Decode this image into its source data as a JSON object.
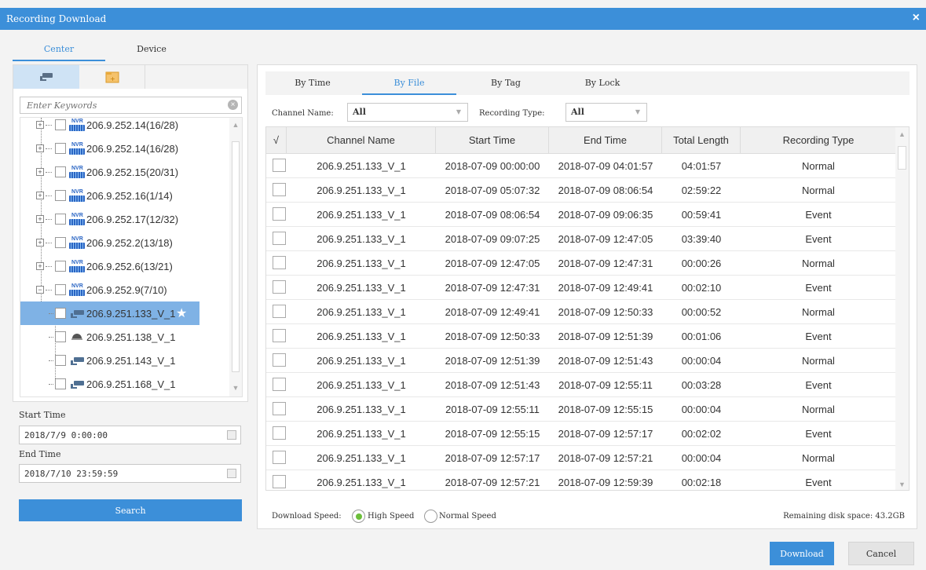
{
  "window": {
    "title": "Recording Download",
    "close_icon": "×"
  },
  "top_tabs": [
    {
      "label": "Center"
    },
    {
      "label": "Device"
    }
  ],
  "left_tabs": [
    {
      "icon": "camera-icon"
    },
    {
      "icon": "folder-icon"
    }
  ],
  "search": {
    "placeholder": "Enter Keywords"
  },
  "tree": [
    {
      "type": "nvr",
      "label": "206.9.252.14(16/28)"
    },
    {
      "type": "nvr",
      "label": "206.9.252.14(16/28)"
    },
    {
      "type": "nvr",
      "label": "206.9.252.15(20/31)"
    },
    {
      "type": "nvr",
      "label": "206.9.252.16(1/14)"
    },
    {
      "type": "nvr",
      "label": "206.9.252.17(12/32)"
    },
    {
      "type": "nvr",
      "label": "206.9.252.2(13/18)"
    },
    {
      "type": "nvr",
      "label": "206.9.252.6(13/21)"
    },
    {
      "type": "nvr",
      "label": "206.9.252.9(7/10)"
    },
    {
      "type": "camera",
      "label": "206.9.251.133_V_1",
      "selected": true
    },
    {
      "type": "dome",
      "label": "206.9.251.138_V_1"
    },
    {
      "type": "camera",
      "label": "206.9.251.143_V_1"
    },
    {
      "type": "camera",
      "label": "206.9.251.168_V_1"
    }
  ],
  "time_range": {
    "start_label": "Start Time",
    "start_value": "2018/7/9 0:00:00",
    "end_label": "End Time",
    "end_value": "2018/7/10 23:59:59"
  },
  "search_button": "Search",
  "right_tabs": [
    {
      "label": "By Time"
    },
    {
      "label": "By File"
    },
    {
      "label": "By Tag"
    },
    {
      "label": "By Lock"
    }
  ],
  "filters": {
    "channel_label": "Channel Name:",
    "channel_value": "All",
    "type_label": "Recording Type:",
    "type_value": "All"
  },
  "table": {
    "columns": [
      "√",
      "Channel Name",
      "Start Time",
      "End Time",
      "Total Length",
      "Recording Type"
    ],
    "rows": [
      [
        "206.9.251.133_V_1",
        "2018-07-09 00:00:00",
        "2018-07-09 04:01:57",
        "04:01:57",
        "Normal"
      ],
      [
        "206.9.251.133_V_1",
        "2018-07-09 05:07:32",
        "2018-07-09 08:06:54",
        "02:59:22",
        "Normal"
      ],
      [
        "206.9.251.133_V_1",
        "2018-07-09 08:06:54",
        "2018-07-09 09:06:35",
        "00:59:41",
        "Event"
      ],
      [
        "206.9.251.133_V_1",
        "2018-07-09 09:07:25",
        "2018-07-09 12:47:05",
        "03:39:40",
        "Event"
      ],
      [
        "206.9.251.133_V_1",
        "2018-07-09 12:47:05",
        "2018-07-09 12:47:31",
        "00:00:26",
        "Normal"
      ],
      [
        "206.9.251.133_V_1",
        "2018-07-09 12:47:31",
        "2018-07-09 12:49:41",
        "00:02:10",
        "Event"
      ],
      [
        "206.9.251.133_V_1",
        "2018-07-09 12:49:41",
        "2018-07-09 12:50:33",
        "00:00:52",
        "Normal"
      ],
      [
        "206.9.251.133_V_1",
        "2018-07-09 12:50:33",
        "2018-07-09 12:51:39",
        "00:01:06",
        "Event"
      ],
      [
        "206.9.251.133_V_1",
        "2018-07-09 12:51:39",
        "2018-07-09 12:51:43",
        "00:00:04",
        "Normal"
      ],
      [
        "206.9.251.133_V_1",
        "2018-07-09 12:51:43",
        "2018-07-09 12:55:11",
        "00:03:28",
        "Event"
      ],
      [
        "206.9.251.133_V_1",
        "2018-07-09 12:55:11",
        "2018-07-09 12:55:15",
        "00:00:04",
        "Normal"
      ],
      [
        "206.9.251.133_V_1",
        "2018-07-09 12:55:15",
        "2018-07-09 12:57:17",
        "00:02:02",
        "Event"
      ],
      [
        "206.9.251.133_V_1",
        "2018-07-09 12:57:17",
        "2018-07-09 12:57:21",
        "00:00:04",
        "Normal"
      ],
      [
        "206.9.251.133_V_1",
        "2018-07-09 12:57:21",
        "2018-07-09 12:59:39",
        "00:02:18",
        "Event"
      ]
    ]
  },
  "download_speed": {
    "label": "Download Speed:",
    "options": [
      "High Speed",
      "Normal Speed"
    ],
    "selected": "High Speed"
  },
  "disk_space": "Remaining disk space: 43.2GB",
  "buttons": {
    "download": "Download",
    "cancel": "Cancel"
  },
  "colors": {
    "accent": "#3c8fd9",
    "selected_row": "#7fb2e5",
    "radio_on": "#6cbf3a"
  }
}
